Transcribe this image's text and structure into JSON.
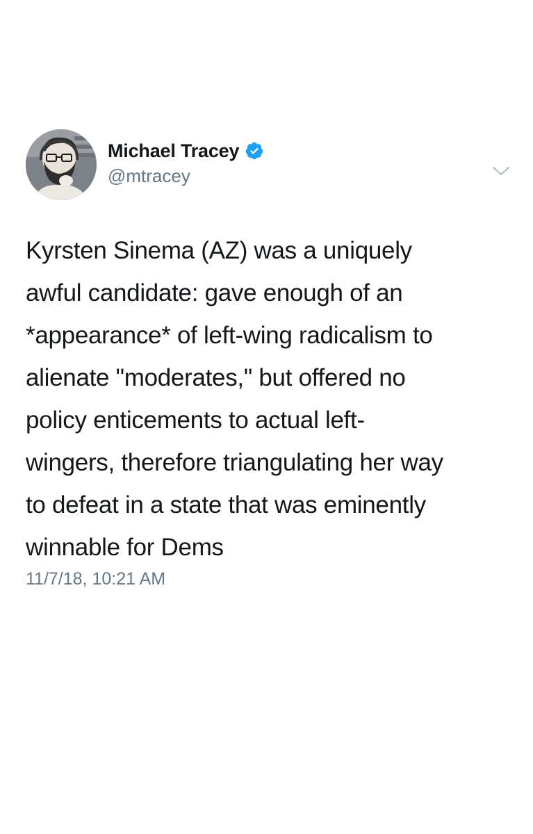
{
  "tweet": {
    "author": {
      "display_name": "Michael Tracey",
      "handle": "@mtracey",
      "verified": true,
      "avatar_icon": "profile-photo"
    },
    "text": "Kyrsten Sinema (AZ) was a uniquely\nawful candidate: gave enough of an\n*appearance* of left-wing radicalism to\nalienate \"moderates,\" but offered no\npolicy enticements to actual left-\nwingers, therefore triangulating her way\nto defeat in a state that was eminently\nwinnable for Dems",
    "timestamp": "11/7/18, 10:21 AM",
    "menu_icon": "chevron-down-icon"
  },
  "colors": {
    "text": "#14171a",
    "secondary_text": "#657786",
    "verified_blue": "#1da1f2",
    "background": "#ffffff"
  }
}
